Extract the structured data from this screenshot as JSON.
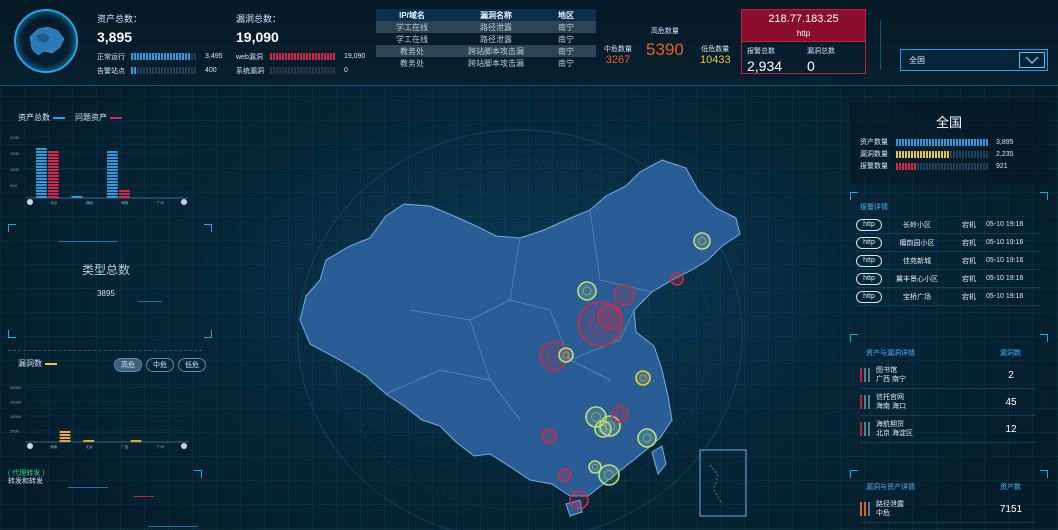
{
  "header": {
    "asset_total_label": "资产总数：",
    "asset_total_value": "3,895",
    "asset_rows": [
      {
        "label": "正常运行",
        "value": "3,495",
        "ratio": 0.9
      },
      {
        "label": "告警站点",
        "value": "400",
        "ratio": 0.1
      }
    ],
    "vuln_total_label": "漏洞总数：",
    "vuln_total_value": "19,090",
    "vuln_rows": [
      {
        "label": "web漏洞",
        "value": "19,090",
        "ratio": 1.0
      },
      {
        "label": "系统漏洞",
        "value": "0",
        "ratio": 0.0
      }
    ],
    "vuln_table": {
      "columns": [
        "IP/域名",
        "漏洞名称",
        "地区"
      ],
      "rows": [
        [
          "学工在线",
          "路径泄露",
          "南宁"
        ],
        [
          "学工在线",
          "路径泄露",
          "南宁"
        ],
        [
          "教务处",
          "跨站脚本攻击漏",
          "南宁"
        ],
        [
          "教务处",
          "跨站脚本攻击漏",
          "南宁"
        ]
      ]
    },
    "severity": {
      "mid_label": "中危数量",
      "mid_value": "3267",
      "high_label": "高危数量",
      "high_value": "5390",
      "low_label": "低危数量",
      "low_value": "10433"
    },
    "alert_ip": "218.77.183.25",
    "alert_proto": "http",
    "alarm_total_label": "报警总数",
    "alarm_total_value": "2,934",
    "vuln_total2_label": "漏洞总数",
    "vuln_total2_value": "0",
    "region_select": "全国"
  },
  "left": {
    "legend_assets": "资产总数",
    "legend_problem": "问题资产",
    "chart1": {
      "type": "bar",
      "categories": [
        "北京",
        "湖南",
        "海南",
        "广州"
      ],
      "series": [
        {
          "name": "资产总数",
          "values": [
            1600,
            100,
            1550,
            10
          ]
        },
        {
          "name": "问题资产",
          "values": [
            1550,
            60,
            300,
            10
          ]
        }
      ],
      "yticks": [
        "2000",
        "1500",
        "1000",
        "500"
      ],
      "ylim": [
        0,
        2000
      ]
    },
    "type_total_label": "类型总数",
    "type_total_value": "3895",
    "vuln_count_label": "漏洞数",
    "chips": [
      "高危",
      "中危",
      "低危"
    ],
    "chart2": {
      "type": "bar",
      "categories": [
        "海南",
        "北京",
        "广西",
        "广州"
      ],
      "series": [
        {
          "name": "漏洞数",
          "values": [
            20,
            4300,
            1100,
            250,
            1300,
            400
          ]
        }
      ],
      "yticks": [
        "20000",
        "15000",
        "10000",
        "5000"
      ],
      "ylim": [
        0,
        20000
      ]
    },
    "bottom_text1": "( 代理转发 )",
    "bottom_text2": "转发和转发"
  },
  "map": {
    "title": "",
    "markers": [
      {
        "cx": 412,
        "cy": 121,
        "r": 8,
        "color": "#b9e07a"
      },
      {
        "cx": 387,
        "cy": 159,
        "r": 6,
        "color": "#c0304a"
      },
      {
        "cx": 334,
        "cy": 175,
        "r": 10,
        "color": "#c0304a"
      },
      {
        "cx": 297,
        "cy": 171,
        "r": 9,
        "color": "#b9e07a"
      },
      {
        "cx": 310,
        "cy": 204,
        "r": 22,
        "color": "#c0304a"
      },
      {
        "cx": 320,
        "cy": 197,
        "r": 12,
        "color": "#c0304a"
      },
      {
        "cx": 264,
        "cy": 236,
        "r": 14,
        "color": "#c0304a"
      },
      {
        "cx": 276,
        "cy": 235,
        "r": 7,
        "color": "#b9e07a"
      },
      {
        "cx": 353,
        "cy": 258,
        "r": 7,
        "color": "#e0d040"
      },
      {
        "cx": 306,
        "cy": 297,
        "r": 10,
        "color": "#b9e07a"
      },
      {
        "cx": 320,
        "cy": 306,
        "r": 10,
        "color": "#b9e07a"
      },
      {
        "cx": 330,
        "cy": 294,
        "r": 8,
        "color": "#c0304a"
      },
      {
        "cx": 313,
        "cy": 309,
        "r": 8,
        "color": "#b9e07a"
      },
      {
        "cx": 357,
        "cy": 318,
        "r": 9,
        "color": "#b9e07a"
      },
      {
        "cx": 259,
        "cy": 316,
        "r": 7,
        "color": "#c0304a"
      },
      {
        "cx": 305,
        "cy": 347,
        "r": 6,
        "color": "#b9e07a"
      },
      {
        "cx": 319,
        "cy": 355,
        "r": 10,
        "color": "#b9e07a"
      },
      {
        "cx": 275,
        "cy": 355,
        "r": 6,
        "color": "#c0304a"
      },
      {
        "cx": 289,
        "cy": 380,
        "r": 9,
        "color": "#c0304a"
      }
    ]
  },
  "right": {
    "region_title": "全国",
    "stats": [
      {
        "label": "资产数量",
        "value": "3,895",
        "ratio": 1.0,
        "color": "#2a9ee0"
      },
      {
        "label": "漏洞数量",
        "value": "2,235",
        "ratio": 0.57,
        "color": "#e8c83a"
      },
      {
        "label": "报警数量",
        "value": "921",
        "ratio": 0.24,
        "color": "#d8284a"
      }
    ],
    "alert_title": "报警详情",
    "alerts": [
      {
        "proto": "http",
        "place": "长岭小区",
        "type": "宕机",
        "time": "05-10 19:16"
      },
      {
        "proto": "http",
        "place": "檀韵园小区",
        "type": "宕机",
        "time": "05-10 19:16"
      },
      {
        "proto": "http",
        "place": "佳苑新城",
        "type": "宕机",
        "time": "05-10 19:16"
      },
      {
        "proto": "http",
        "place": "翼丰景心小区",
        "type": "宕机",
        "time": "05-10 19:16"
      },
      {
        "proto": "http",
        "place": "宝桥广场",
        "type": "宕机",
        "time": "05-10 19:16"
      }
    ],
    "asset_vuln_title": "资产与漏洞详情",
    "asset_vuln_col": "漏洞数",
    "asset_vuln_rows": [
      {
        "name": "图书馆",
        "region": "广西 南宁",
        "count": "2"
      },
      {
        "name": "信托官网",
        "region": "海南 海口",
        "count": "45"
      },
      {
        "name": "海航期货",
        "region": "北京 海淀区",
        "count": "12"
      }
    ],
    "vuln_asset_title": "漏洞与资产详情",
    "vuln_asset_col": "资产数",
    "vuln_asset_rows": [
      {
        "name": "路径泄露",
        "level": "中危",
        "count": "7151"
      }
    ]
  },
  "colors": {
    "accent": "#2a9ee0",
    "danger": "#d8284a",
    "warn": "#e8c83a",
    "map_fill": "#2a5d95",
    "marker_green": "#b9e07a"
  }
}
